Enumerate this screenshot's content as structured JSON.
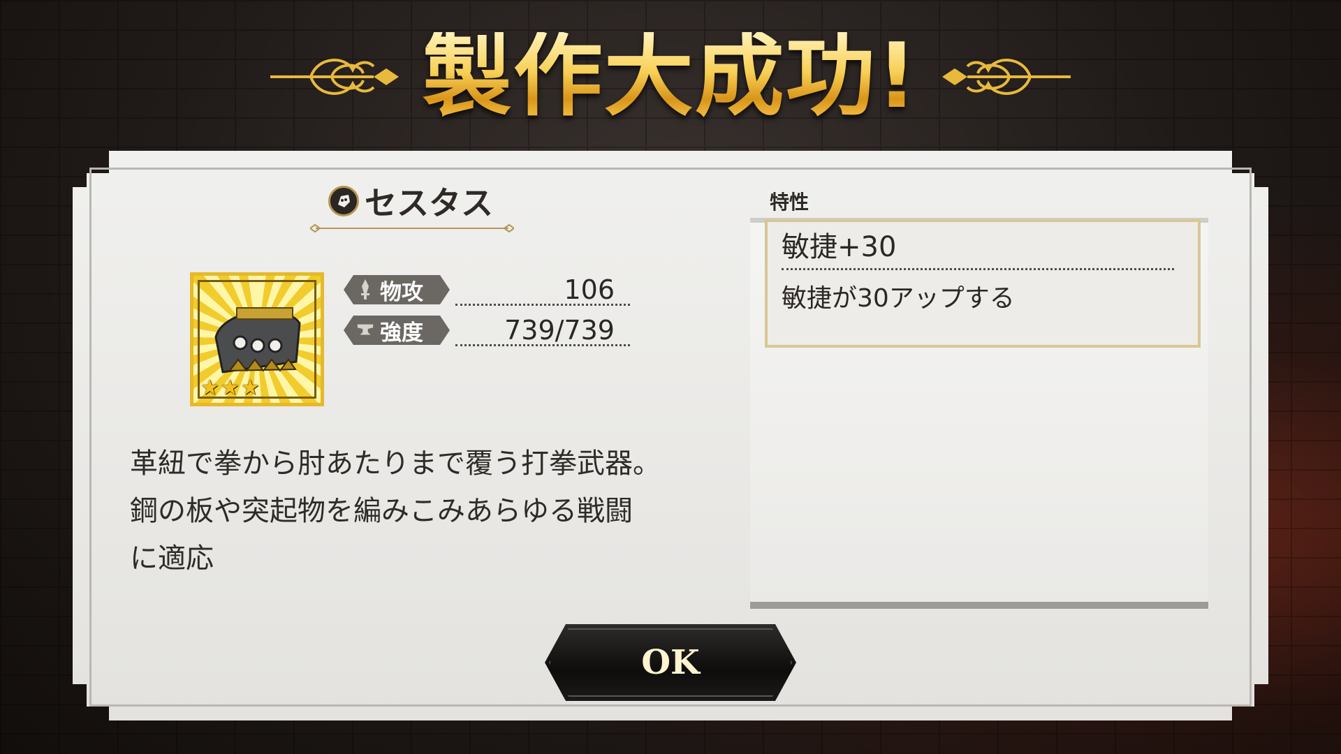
{
  "title": "製作大成功!",
  "item": {
    "type_icon": "gauntlet-icon",
    "name": "セスタス",
    "rarity_stars": 3,
    "icon": "cestus-weapon-icon"
  },
  "stats": [
    {
      "icon": "sword-icon",
      "label": "物攻",
      "value": "106"
    },
    {
      "icon": "anvil-icon",
      "label": "強度",
      "value": "739/739"
    }
  ],
  "description": [
    "革紐で拳から肘あたりまで覆う打拳武器。",
    "鋼の板や突起物を編みこみあらゆる戦闘",
    "に適応"
  ],
  "traits": {
    "header": "特性",
    "items": [
      {
        "name": "敏捷+30",
        "desc": "敏捷が30アップする"
      }
    ]
  },
  "ok_label": "OK",
  "colors": {
    "gold": "#f7cf55",
    "panel": "#ecebe8",
    "button": "#141312"
  }
}
